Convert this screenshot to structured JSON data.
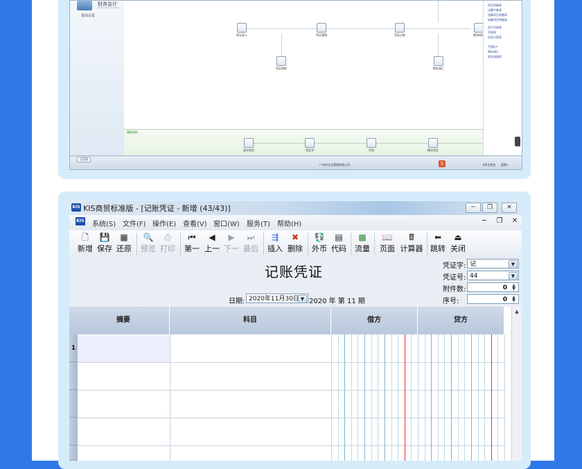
{
  "finance": {
    "logo_title": "财务会计",
    "logo_sub": "Financial Accounting",
    "side_item": "基础设置",
    "flow_nodes": [
      "凭证录入",
      "凭证管理",
      "凭证过账",
      "期末结账",
      "凭证审核",
      "期末调汇"
    ],
    "basic_title": "基础资料",
    "basic_nodes": [
      "会计科目",
      "凭证字",
      "币别",
      "模式凭证",
      "现金流量项目"
    ],
    "right_links": [
      "科目余额表",
      "试算平衡表",
      "核算项目余额表",
      "核算项目明细表",
      "资产负债表",
      "利润表",
      "自定义报表",
      "T型账户",
      "期末调汇",
      "现金流量表"
    ],
    "status_tab": "主页面",
    "status_company": "广州市企业管理有限公司",
    "status_sys": "KIS主控台",
    "status_clock": "星期一"
  },
  "window": {
    "icon": "KIS",
    "title": "KIS商贸标准版 - [记账凭证 - 新增 (43/43)]",
    "menu": [
      "系统(S)",
      "文件(F)",
      "操作(E)",
      "查看(V)",
      "窗口(W)",
      "服务(T)",
      "帮助(H)"
    ],
    "toolbar": [
      {
        "label": "新增",
        "glyph": "🗋"
      },
      {
        "label": "保存",
        "glyph": "💾"
      },
      {
        "label": "还原",
        "glyph": "▦"
      },
      {
        "label": "预览",
        "glyph": "🔍"
      },
      {
        "label": "打印",
        "glyph": "⎙"
      },
      {
        "label": "第一",
        "glyph": "⏮"
      },
      {
        "label": "上一",
        "glyph": "◀"
      },
      {
        "label": "下一",
        "glyph": "▶"
      },
      {
        "label": "最后",
        "glyph": "⏭"
      },
      {
        "label": "插入",
        "glyph": "⇶"
      },
      {
        "label": "删除",
        "glyph": "✖"
      },
      {
        "label": "外币",
        "glyph": "💱"
      },
      {
        "label": "代码",
        "glyph": "▤"
      },
      {
        "label": "流量",
        "glyph": "▩"
      },
      {
        "label": "页面",
        "glyph": "📖"
      },
      {
        "label": "计算器",
        "glyph": "🖩"
      },
      {
        "label": "跳转",
        "glyph": "⬅"
      },
      {
        "label": "关闭",
        "glyph": "⏏"
      }
    ]
  },
  "voucher": {
    "title": "记账凭证",
    "date_label": "日期:",
    "date_value": "2020年11月30日",
    "year_text": "2020 年 第 11 期",
    "fields": {
      "word_label": "凭证字:",
      "word_value": "记",
      "no_label": "凭证号:",
      "no_value": "44",
      "attach_label": "附件数:",
      "attach_value": "0",
      "seq_label": "序号:",
      "seq_value": "0"
    },
    "columns": [
      "摘要",
      "科目",
      "借方",
      "贷方"
    ],
    "first_row": "1"
  }
}
